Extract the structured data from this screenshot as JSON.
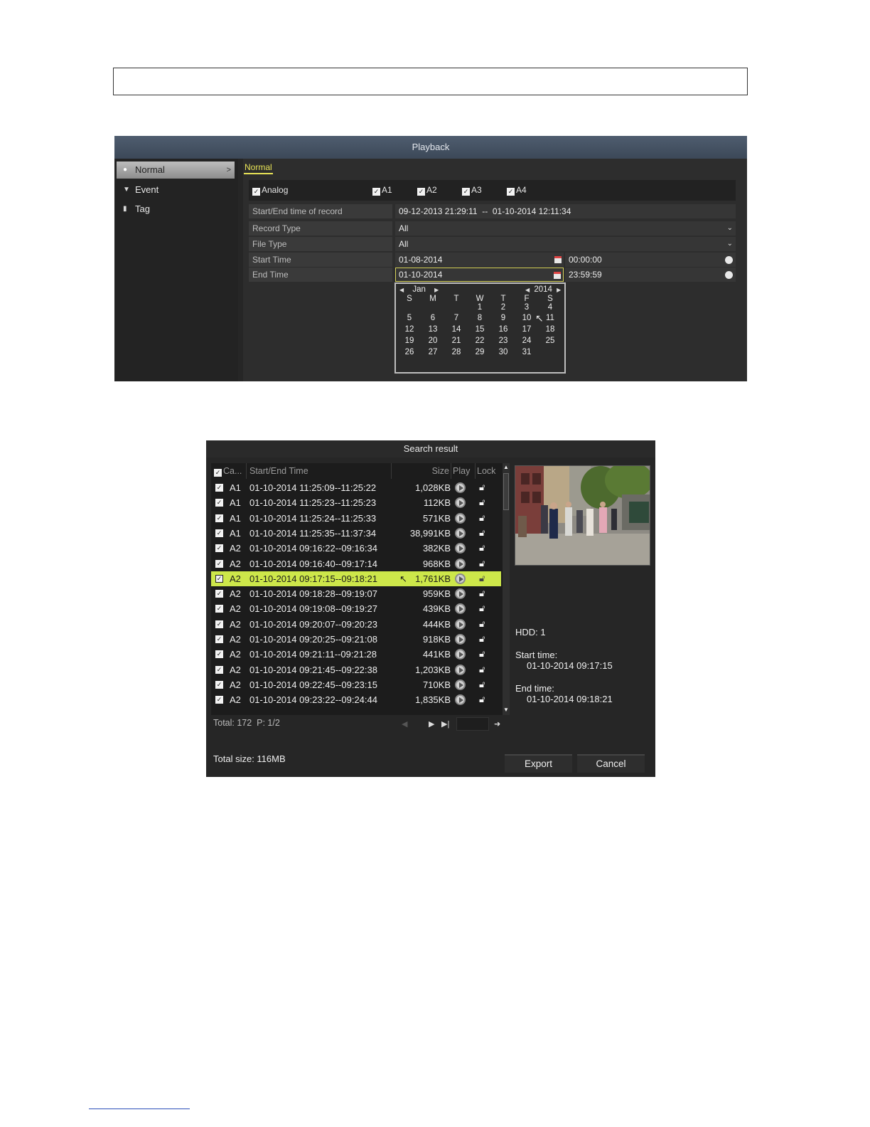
{
  "playback": {
    "title": "Playback",
    "sidebar": [
      {
        "label": "Normal",
        "icon": "playback-normal-icon"
      },
      {
        "label": "Event",
        "icon": "pin-icon"
      },
      {
        "label": "Tag",
        "icon": "tag-icon"
      }
    ],
    "tab": "Normal",
    "channels": {
      "group": "Analog",
      "items": [
        "A1",
        "A2",
        "A3",
        "A4"
      ]
    },
    "fields": {
      "record_range_label": "Start/End time of record",
      "record_range_value": "09-12-2013 21:29:11  --  01-10-2014 12:11:34",
      "record_type_label": "Record Type",
      "record_type_value": "All",
      "file_type_label": "File Type",
      "file_type_value": "All",
      "start_time_label": "Start Time",
      "start_date": "01-08-2014",
      "start_clock": "00:00:00",
      "end_time_label": "End Time",
      "end_date": "01-10-2014",
      "end_clock": "23:59:59"
    },
    "calendar": {
      "month": "Jan",
      "year": "2014",
      "weekdays": [
        "S",
        "M",
        "T",
        "W",
        "T",
        "F",
        "S"
      ],
      "first_weekday_index": 3,
      "days_in_month": 31
    }
  },
  "search": {
    "title": "Search result",
    "columns": {
      "camera": "Ca...",
      "time": "Start/End Time",
      "size": "Size",
      "play": "Play",
      "lock": "Lock"
    },
    "rows": [
      {
        "ch": "A1",
        "time": "01-10-2014 11:25:09--11:25:22",
        "size": "1,028KB"
      },
      {
        "ch": "A1",
        "time": "01-10-2014 11:25:23--11:25:23",
        "size": "112KB"
      },
      {
        "ch": "A1",
        "time": "01-10-2014 11:25:24--11:25:33",
        "size": "571KB"
      },
      {
        "ch": "A1",
        "time": "01-10-2014 11:25:35--11:37:34",
        "size": "38,991KB"
      },
      {
        "ch": "A2",
        "time": "01-10-2014 09:16:22--09:16:34",
        "size": "382KB"
      },
      {
        "ch": "A2",
        "time": "01-10-2014 09:16:40--09:17:14",
        "size": "968KB"
      },
      {
        "ch": "A2",
        "time": "01-10-2014 09:17:15--09:18:21",
        "size": "1,761KB",
        "selected": true
      },
      {
        "ch": "A2",
        "time": "01-10-2014 09:18:28--09:19:07",
        "size": "959KB"
      },
      {
        "ch": "A2",
        "time": "01-10-2014 09:19:08--09:19:27",
        "size": "439KB"
      },
      {
        "ch": "A2",
        "time": "01-10-2014 09:20:07--09:20:23",
        "size": "444KB"
      },
      {
        "ch": "A2",
        "time": "01-10-2014 09:20:25--09:21:08",
        "size": "918KB"
      },
      {
        "ch": "A2",
        "time": "01-10-2014 09:21:11--09:21:28",
        "size": "441KB"
      },
      {
        "ch": "A2",
        "time": "01-10-2014 09:21:45--09:22:38",
        "size": "1,203KB"
      },
      {
        "ch": "A2",
        "time": "01-10-2014 09:22:45--09:23:15",
        "size": "710KB"
      },
      {
        "ch": "A2",
        "time": "01-10-2014 09:23:22--09:24:44",
        "size": "1,835KB"
      }
    ],
    "paging": "Total: 172  P: 1/2",
    "info": {
      "hdd": "HDD: 1",
      "start_label": "Start time:",
      "start_value": "01-10-2014 09:17:15",
      "end_label": "End time:",
      "end_value": "01-10-2014 09:18:21"
    },
    "total_size": "Total size: 116MB",
    "export_label": "Export",
    "cancel_label": "Cancel"
  },
  "colors": {
    "title_bar": "#4a5668",
    "accent_yellow": "#e8e356",
    "selected_row": "#cde74a"
  }
}
